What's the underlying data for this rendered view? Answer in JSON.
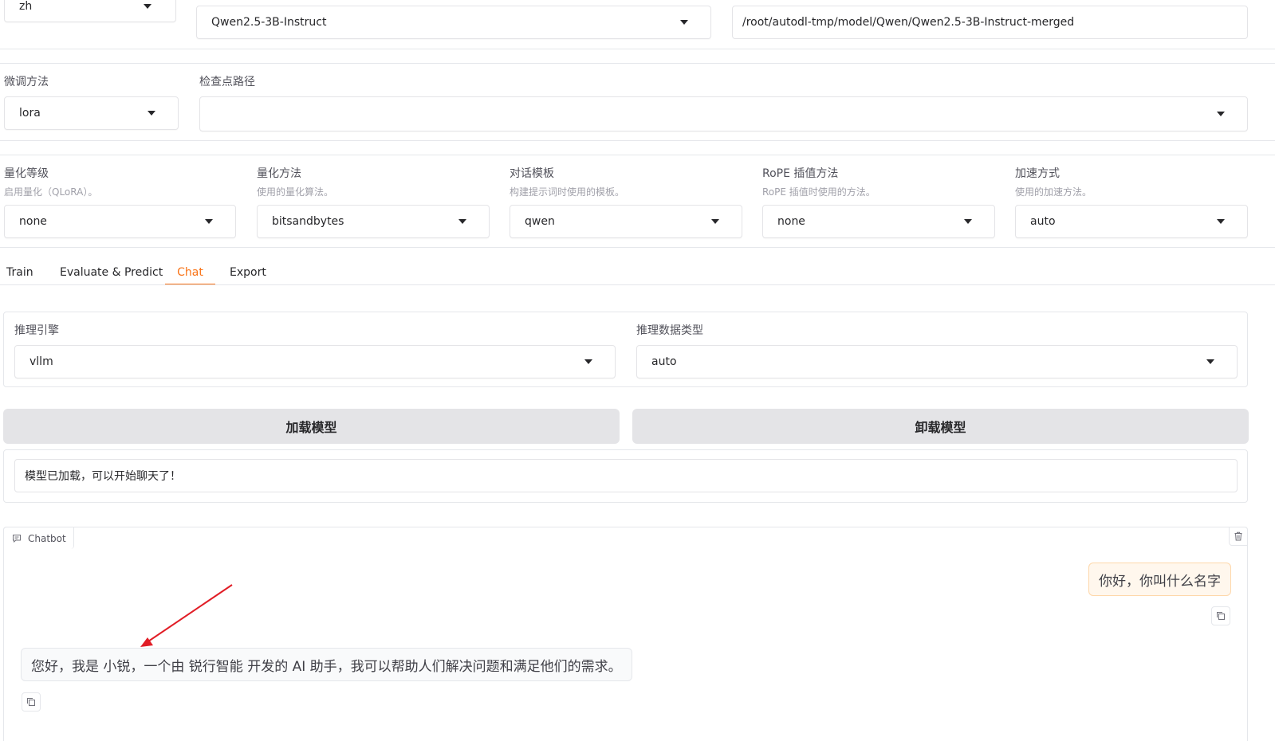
{
  "top": {
    "lang_value": "zh",
    "model_name": "Qwen2.5-3B-Instruct",
    "model_path": "/root/autodl-tmp/model/Qwen/Qwen2.5-3B-Instruct-merged"
  },
  "finetune": {
    "method_label": "微调方法",
    "method_value": "lora",
    "checkpoint_label": "检查点路径",
    "checkpoint_value": ""
  },
  "advanced": {
    "quant_bit_label": "量化等级",
    "quant_bit_info": "启用量化（QLoRA）。",
    "quant_bit_value": "none",
    "quant_method_label": "量化方法",
    "quant_method_info": "使用的量化算法。",
    "quant_method_value": "bitsandbytes",
    "template_label": "对话模板",
    "template_info": "构建提示词时使用的模板。",
    "template_value": "qwen",
    "rope_label": "RoPE 插值方法",
    "rope_info": "RoPE 插值时使用的方法。",
    "rope_value": "none",
    "booster_label": "加速方式",
    "booster_info": "使用的加速方法。",
    "booster_value": "auto"
  },
  "tabs": [
    "Train",
    "Evaluate & Predict",
    "Chat",
    "Export"
  ],
  "active_tab": "Chat",
  "chat": {
    "infer_backend_label": "推理引擎",
    "infer_backend_value": "vllm",
    "infer_dtype_label": "推理数据类型",
    "infer_dtype_value": "auto",
    "load_button": "加载模型",
    "unload_button": "卸载模型",
    "info_box": "模型已加载，可以开始聊天了！",
    "chatbot_label": "Chatbot",
    "messages": [
      {
        "role": "user",
        "text": "你好，你叫什么名字"
      },
      {
        "role": "assistant",
        "text": "您好，我是 小锐，一个由 锐行智能 开发的 AI 助手，我可以帮助人们解决问题和满足他们的需求。"
      }
    ]
  },
  "colors": {
    "accent": "#f97316",
    "annotation_arrow": "#e11d26"
  }
}
